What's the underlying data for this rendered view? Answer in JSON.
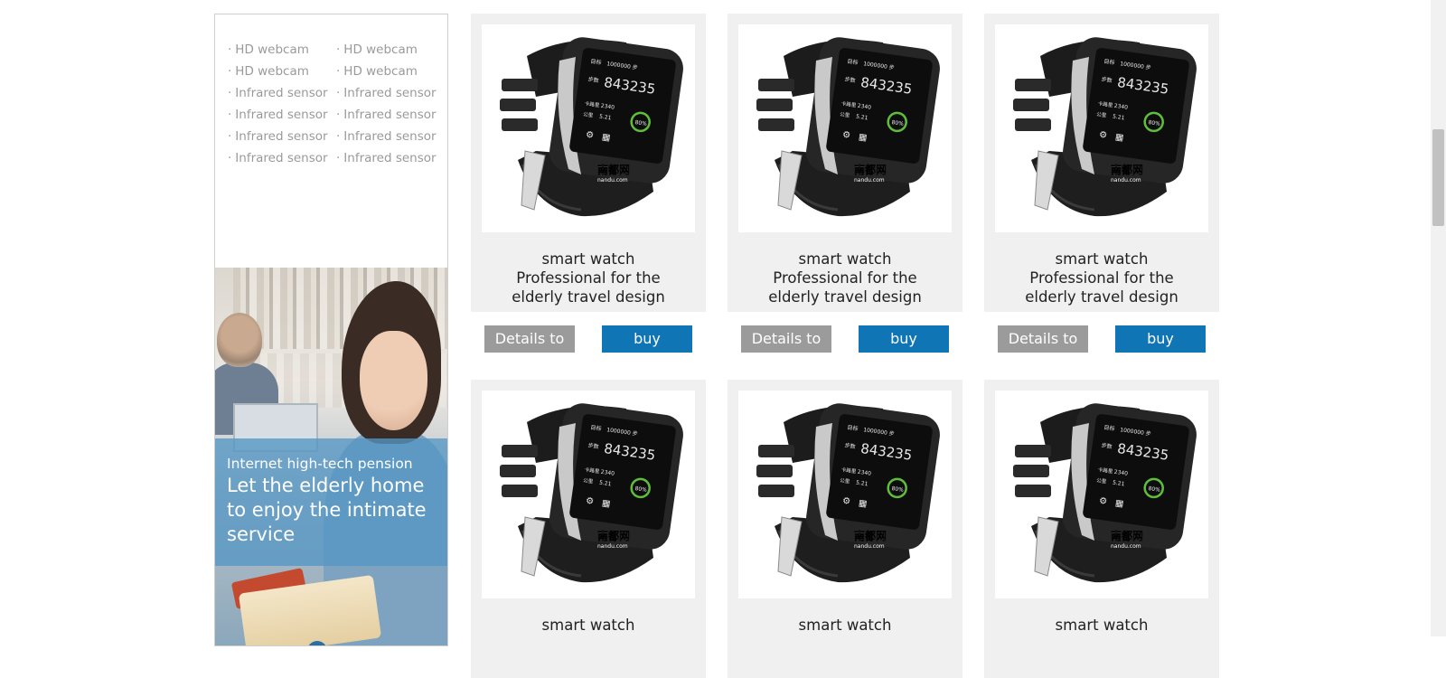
{
  "sidebar": {
    "features": [
      "HD webcam",
      "HD webcam",
      "HD webcam",
      "HD webcam",
      "Infrared sensor",
      "Infrared sensor",
      "Infrared sensor",
      "Infrared sensor",
      "Infrared sensor",
      "Infrared sensor",
      "Infrared sensor",
      "Infrared sensor"
    ],
    "bullet": "·",
    "promo": {
      "subtitle": "Internet high-tech pension",
      "title": "Let the elderly home to enjoy the intimate service"
    }
  },
  "products": [
    {
      "name": "smart watch",
      "desc": "Professional for the elderly travel design",
      "details_label": "Details to",
      "buy_label": "buy",
      "screen": {
        "label": "目标",
        "goal": "1000000 步",
        "steps_label": "步数",
        "steps": "843235",
        "cal_label": "卡路里",
        "cal": "2340",
        "km_label": "公里",
        "km": "5.21",
        "pct": "80%",
        "watermark": "南都网",
        "watermark_sub": "nandu.com"
      }
    },
    {
      "name": "smart watch",
      "desc": "Professional for the elderly travel design",
      "details_label": "Details to",
      "buy_label": "buy",
      "screen": {
        "label": "目标",
        "goal": "1000000 步",
        "steps_label": "步数",
        "steps": "843235",
        "cal_label": "卡路里",
        "cal": "2340",
        "km_label": "公里",
        "km": "5.21",
        "pct": "80%",
        "watermark": "南都网",
        "watermark_sub": "nandu.com"
      }
    },
    {
      "name": "smart watch",
      "desc": "Professional for the elderly travel design",
      "details_label": "Details to",
      "buy_label": "buy",
      "screen": {
        "label": "目标",
        "goal": "1000000 步",
        "steps_label": "步数",
        "steps": "843235",
        "cal_label": "卡路里",
        "cal": "2340",
        "km_label": "公里",
        "km": "5.21",
        "pct": "80%",
        "watermark": "南都网",
        "watermark_sub": "nandu.com"
      }
    },
    {
      "name": "smart watch",
      "desc": "",
      "details_label": "",
      "buy_label": "",
      "screen": {
        "label": "目标",
        "goal": "1000000 步",
        "steps_label": "步数",
        "steps": "843235",
        "cal_label": "卡路里",
        "cal": "2340",
        "km_label": "公里",
        "km": "5.21",
        "pct": "80%",
        "watermark": "南都网",
        "watermark_sub": "nandu.com"
      }
    },
    {
      "name": "smart watch",
      "desc": "",
      "details_label": "",
      "buy_label": "",
      "screen": {
        "label": "目标",
        "goal": "1000000 步",
        "steps_label": "步数",
        "steps": "843235",
        "cal_label": "卡路里",
        "cal": "2340",
        "km_label": "公里",
        "km": "5.21",
        "pct": "80%",
        "watermark": "南都网",
        "watermark_sub": "nandu.com"
      }
    },
    {
      "name": "smart watch",
      "desc": "",
      "details_label": "",
      "buy_label": "",
      "screen": {
        "label": "目标",
        "goal": "1000000 步",
        "steps_label": "步数",
        "steps": "843235",
        "cal_label": "卡路里",
        "cal": "2340",
        "km_label": "公里",
        "km": "5.21",
        "pct": "80%",
        "watermark": "南都网",
        "watermark_sub": "nandu.com"
      }
    }
  ],
  "colors": {
    "details_button": "#9b9b9b",
    "buy_button": "#0f75b5",
    "card_background": "#f0f0f0",
    "feature_text": "#9a9a9a",
    "promo_overlay": "#5496c4"
  }
}
